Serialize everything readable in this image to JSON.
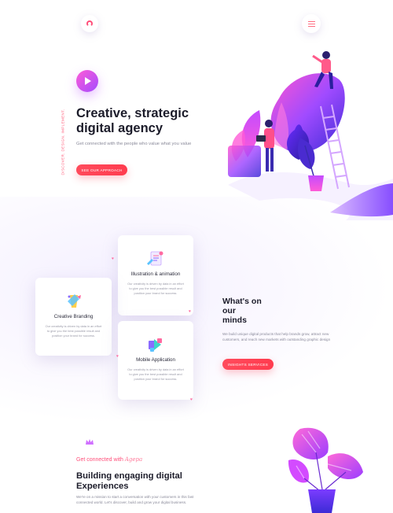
{
  "header": {
    "logo_icon": "ring-logo-icon",
    "menu_icon": "hamburger-menu-icon"
  },
  "hero": {
    "side_tag": "DISCOVER. DESIGN. IMPLEMENT.",
    "play_icon": "play-icon",
    "title_line1": "Creative, strategic",
    "title_line2": "digital agency",
    "subtitle": "Get connected with the people who value what you value",
    "cta_label": "SEE OUR APPROACH"
  },
  "services": {
    "cards": [
      {
        "title": "Illustration & animation",
        "text": "Our creativity is driven by data in an effort to give you the best possible result and position your brand for success."
      },
      {
        "title": "Creative Branding",
        "text": "Our creativity is driven by data in an effort to give you the best possible result and position your brand for success."
      },
      {
        "title": "Mobile Application",
        "text": "Our creativity is driven by data in an effort to give you the best possible result and position your brand for success."
      }
    ],
    "heading_line1": "What's on",
    "heading_line2": "our",
    "heading_line3": "minds",
    "text": "We build unique digital products that help brands grow, attract new customers, and reach new markets with outstanding graphic design",
    "cta_label": "INSIGHTS SERVICES"
  },
  "connect": {
    "prefix": "Get connected with ",
    "brand": "Agepa",
    "title_line1": "Building engaging digital",
    "title_line2": "Experiences",
    "text": "We're on a mission to start a conversation with your customers in this fast connected world. Let's discover, build and grow your digital business."
  },
  "colors": {
    "accent": "#ff4b5c",
    "purple": "#8a3cff",
    "magenta": "#ff5bd7"
  }
}
